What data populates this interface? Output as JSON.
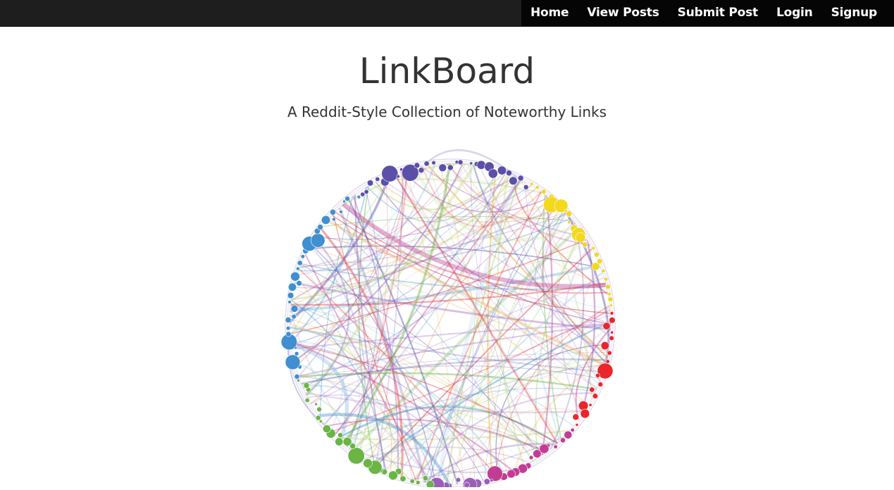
{
  "nav": {
    "items": [
      {
        "label": "Home"
      },
      {
        "label": "View Posts"
      },
      {
        "label": "Submit Post"
      },
      {
        "label": "Login"
      },
      {
        "label": "Signup"
      }
    ]
  },
  "header": {
    "title": "LinkBoard",
    "subtitle": "A Reddit-Style Collection of Noteworthy Links"
  },
  "hero_graphic": {
    "icon": "circular-network-graph",
    "palette": [
      "#5b4fa8",
      "#f2d81e",
      "#e8262b",
      "#c23c94",
      "#6ab545",
      "#3f8fd1",
      "#f4a23a",
      "#9a5fb8"
    ]
  }
}
